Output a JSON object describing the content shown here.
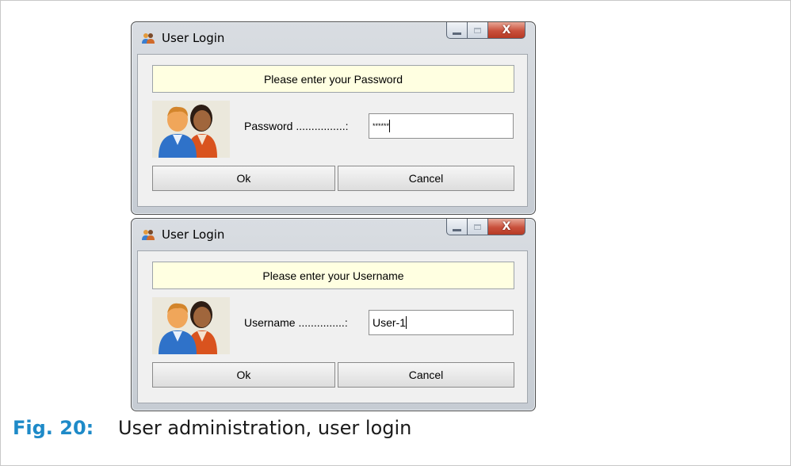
{
  "dialogs": [
    {
      "title": "User Login",
      "prompt": "Please enter your Password",
      "field_label": "Password ................:",
      "field_value": "******",
      "ok_label": "Ok",
      "cancel_label": "Cancel"
    },
    {
      "title": "User Login",
      "prompt": "Please enter your Username",
      "field_label": "Username ...............:",
      "field_value": "User-1",
      "ok_label": "Ok",
      "cancel_label": "Cancel"
    }
  ],
  "caption": {
    "number": "Fig. 20:",
    "text": "User administration, user login"
  },
  "icons": {
    "app_icon": "users-icon",
    "avatar": "users-avatar-icon",
    "minimize": "minimize-icon",
    "maximize": "maximize-icon",
    "close": "close-icon"
  },
  "colors": {
    "caption_accent": "#1e8ac8",
    "prompt_background": "#ffffe1",
    "close_button": "#c9503c"
  }
}
